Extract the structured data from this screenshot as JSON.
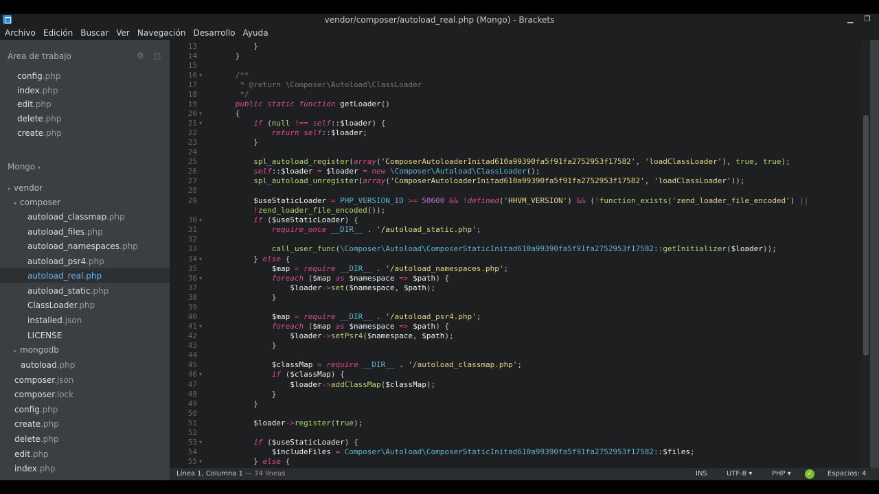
{
  "window": {
    "title": "vendor/composer/autoload_real.php (Mongo) - Brackets",
    "minimize_glyph": "▁",
    "maximize_glyph": "❐"
  },
  "menu": [
    "Archivo",
    "Edición",
    "Buscar",
    "Ver",
    "Navegación",
    "Desarrollo",
    "Ayuda"
  ],
  "sidebar": {
    "working_set_title": "Área de trabajo",
    "working_files": [
      {
        "name": "config",
        "ext": ".php"
      },
      {
        "name": "index",
        "ext": ".php"
      },
      {
        "name": "edit",
        "ext": ".php"
      },
      {
        "name": "delete",
        "ext": ".php"
      },
      {
        "name": "create",
        "ext": ".php"
      }
    ],
    "project_title": "Mongo",
    "tree": {
      "vendor": "vendor",
      "composer": "composer",
      "composer_files": [
        {
          "name": "autoload_classmap",
          "ext": ".php"
        },
        {
          "name": "autoload_files",
          "ext": ".php"
        },
        {
          "name": "autoload_namespaces",
          "ext": ".php"
        },
        {
          "name": "autoload_psr4",
          "ext": ".php"
        },
        {
          "name": "autoload_real",
          "ext": ".php"
        },
        {
          "name": "autoload_static",
          "ext": ".php"
        },
        {
          "name": "ClassLoader",
          "ext": ".php"
        },
        {
          "name": "installed",
          "ext": ".json"
        },
        {
          "name": "LICENSE",
          "ext": ""
        }
      ],
      "mongodb": "mongodb",
      "autoload": {
        "name": "autoload",
        "ext": ".php"
      },
      "root_files": [
        {
          "name": "composer",
          "ext": ".json"
        },
        {
          "name": "composer",
          "ext": ".lock"
        },
        {
          "name": "config",
          "ext": ".php"
        },
        {
          "name": "create",
          "ext": ".php"
        },
        {
          "name": "delete",
          "ext": ".php"
        },
        {
          "name": "edit",
          "ext": ".php"
        },
        {
          "name": "index",
          "ext": ".php"
        }
      ]
    }
  },
  "editor": {
    "lines": {
      "l13": "13",
      "l14": "14",
      "l15": "15",
      "l16": "16",
      "l17": "17",
      "l18": "18",
      "l19": "19",
      "l20": "20",
      "l21": "21",
      "l22": "22",
      "l23": "23",
      "l24": "24",
      "l25": "25",
      "l26": "26",
      "l27": "27",
      "l28": "28",
      "l29": "29",
      "l30": "30",
      "l31": "31",
      "l32": "32",
      "l33": "33",
      "l34": "34",
      "l35": "35",
      "l36": "36",
      "l37": "37",
      "l38": "38",
      "l39": "39",
      "l40": "40",
      "l41": "41",
      "l42": "42",
      "l43": "43",
      "l44": "44",
      "l45": "45",
      "l46": "46",
      "l47": "47",
      "l48": "48",
      "l49": "49",
      "l50": "50",
      "l51": "51",
      "l52": "52",
      "l53": "53",
      "l54": "54",
      "l55": "55"
    }
  },
  "status": {
    "cursor": "Línea 1, Columna 1",
    "line_count": " — 74 líneas",
    "ins": "INS",
    "encoding": "UTF-8 ▾",
    "language": "PHP ▾",
    "lint_ok": "✓",
    "spaces": "Espacios: 4"
  }
}
